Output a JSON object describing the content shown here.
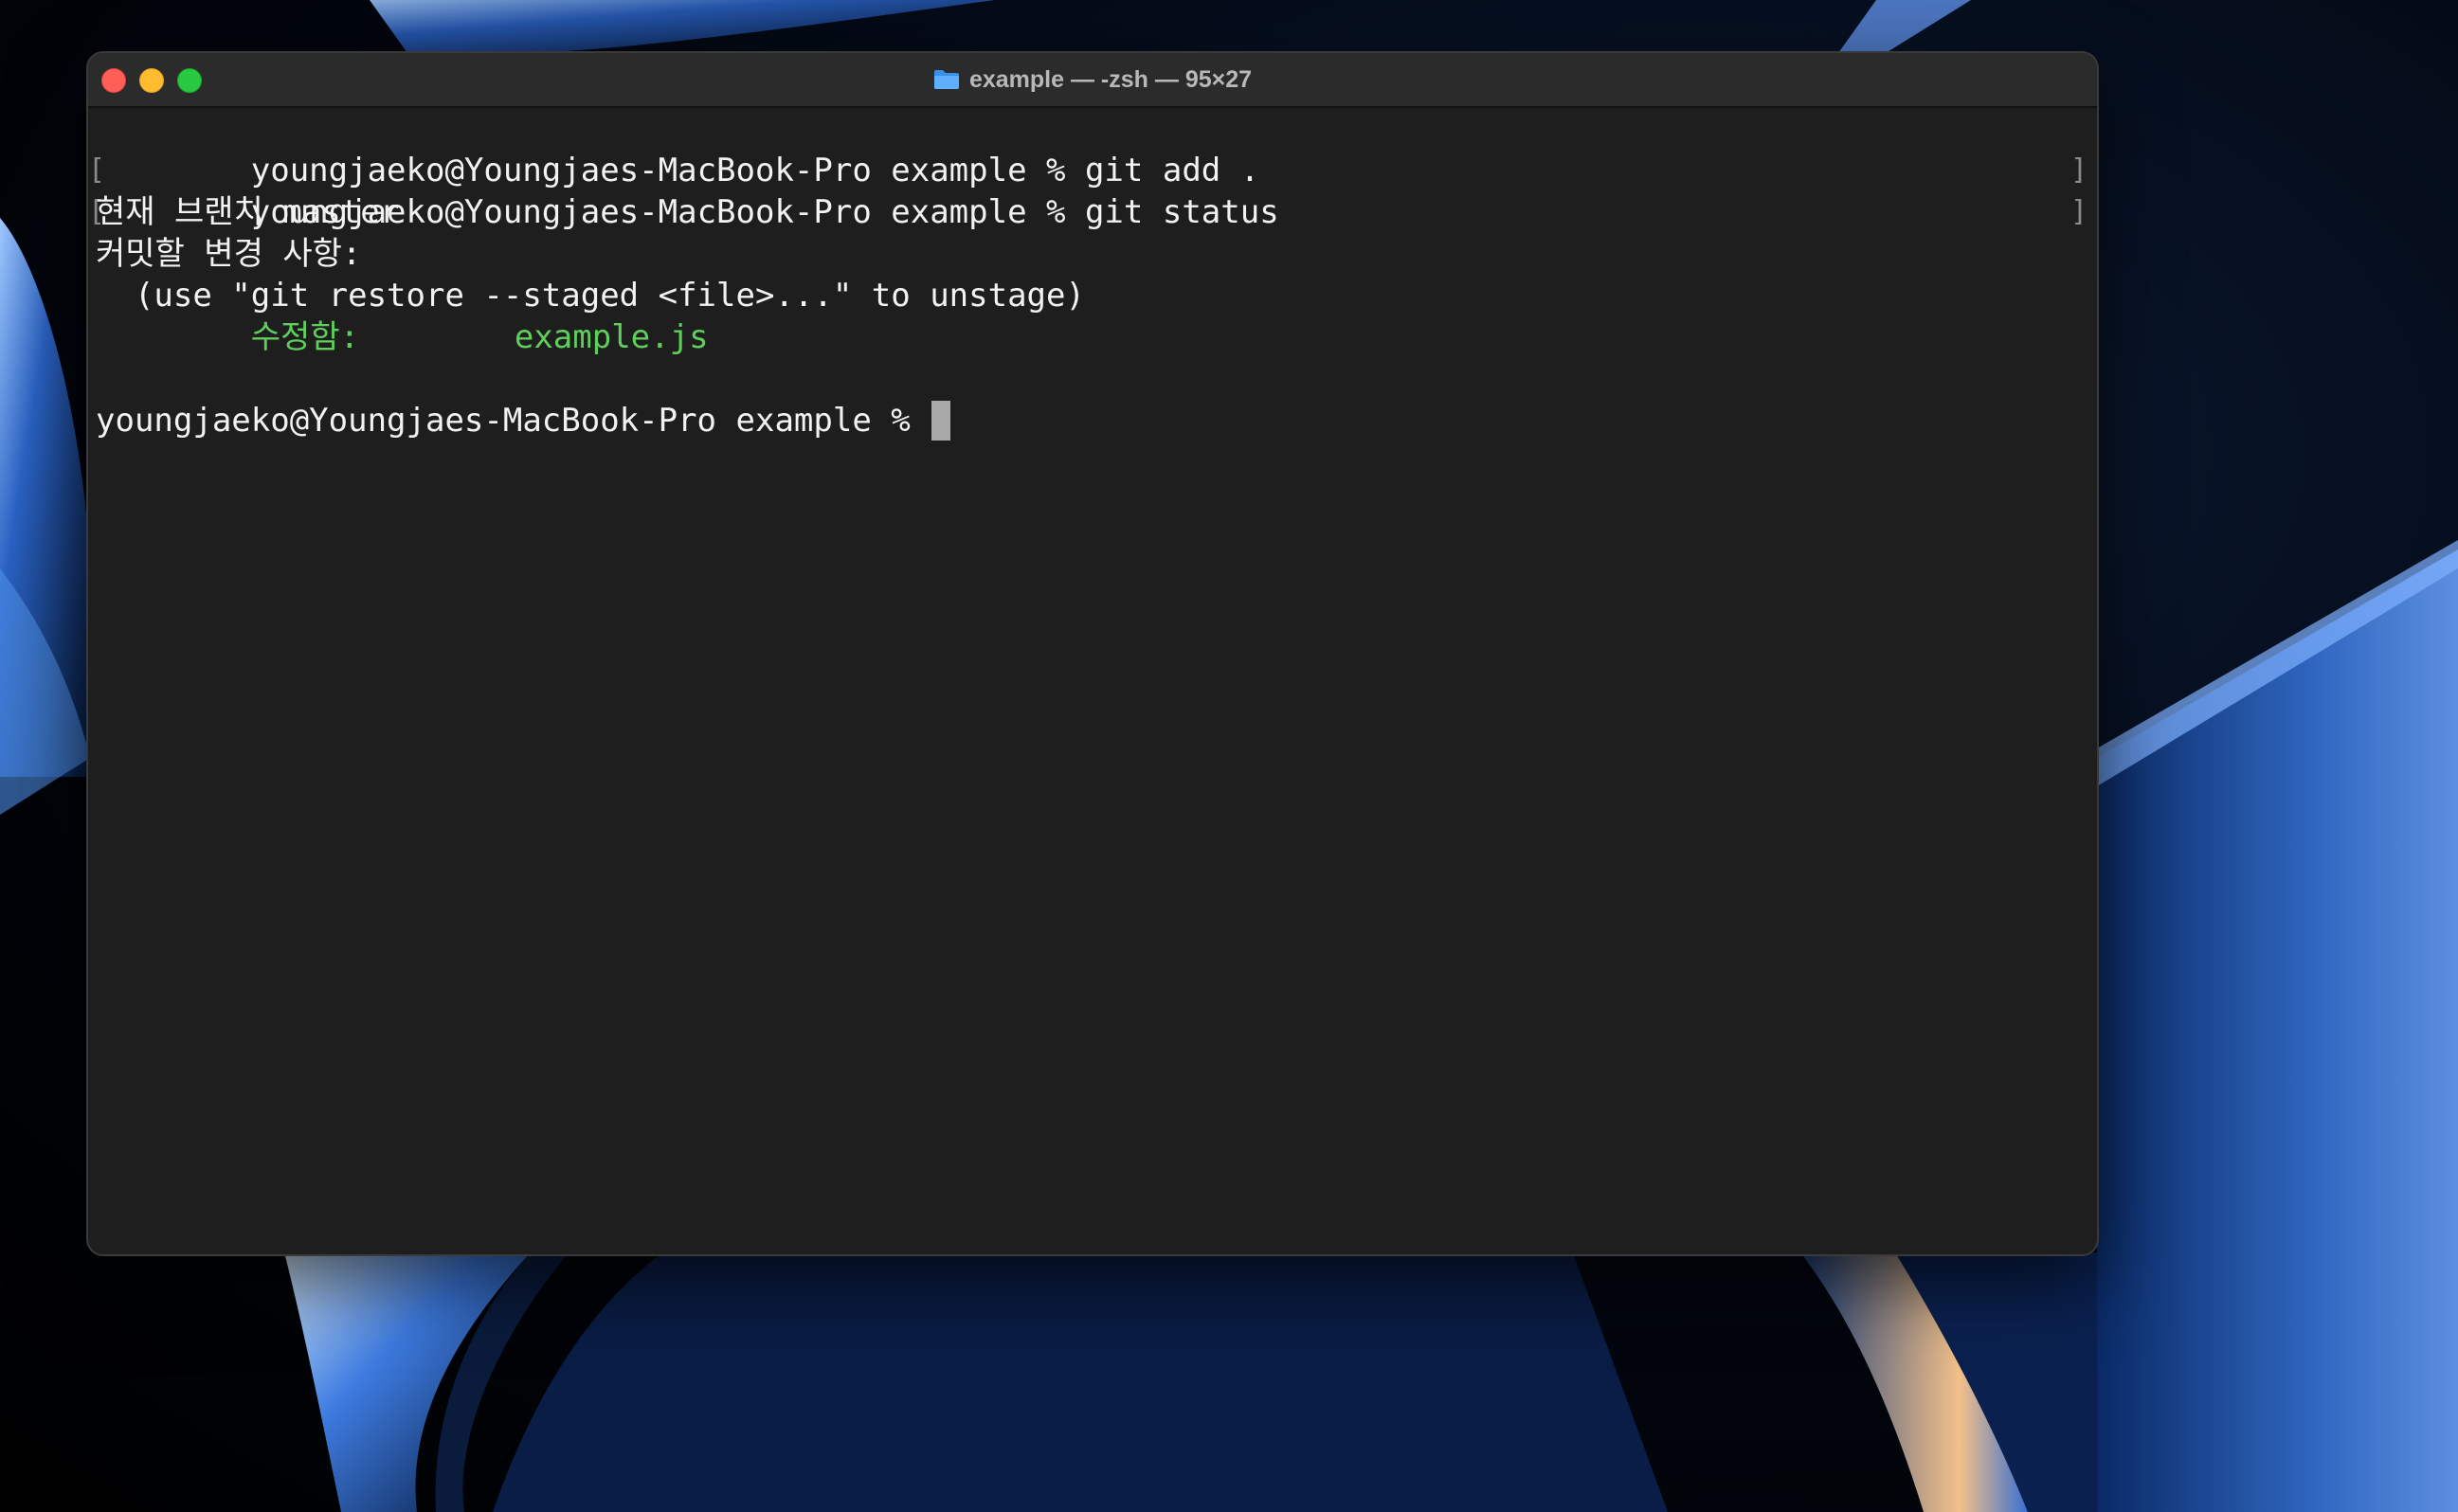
{
  "window": {
    "title": "example — -zsh — 95×27"
  },
  "colors": {
    "terminal_bg": "#1e1e1e",
    "text": "#f2f2f2",
    "staged_green": "#5fcf5b",
    "cursor": "#a9a9a9",
    "close": "#ff5f57",
    "minimize": "#febc2e",
    "maximize": "#28c840"
  },
  "terminal": {
    "lines": {
      "l1": "youngjaeko@Youngjaes-MacBook-Pro example % git add .",
      "l2": "youngjaeko@Youngjaes-MacBook-Pro example % git status",
      "l3": "현재 브랜치 master",
      "l4": "커밋할 변경 사항:",
      "l5": "  (use \"git restore --staged <file>...\" to unstage)",
      "l6_indent": "        ",
      "l6_label": "수정함:",
      "l6_gap": "        ",
      "l6_file": "example.js",
      "l8_prompt": "youngjaeko@Youngjaes-MacBook-Pro example % "
    },
    "mark_left": "[",
    "mark_right": "]"
  },
  "icons": {
    "folder": "folder-icon",
    "close": "close-icon",
    "minimize": "minimize-icon",
    "maximize": "maximize-icon"
  }
}
